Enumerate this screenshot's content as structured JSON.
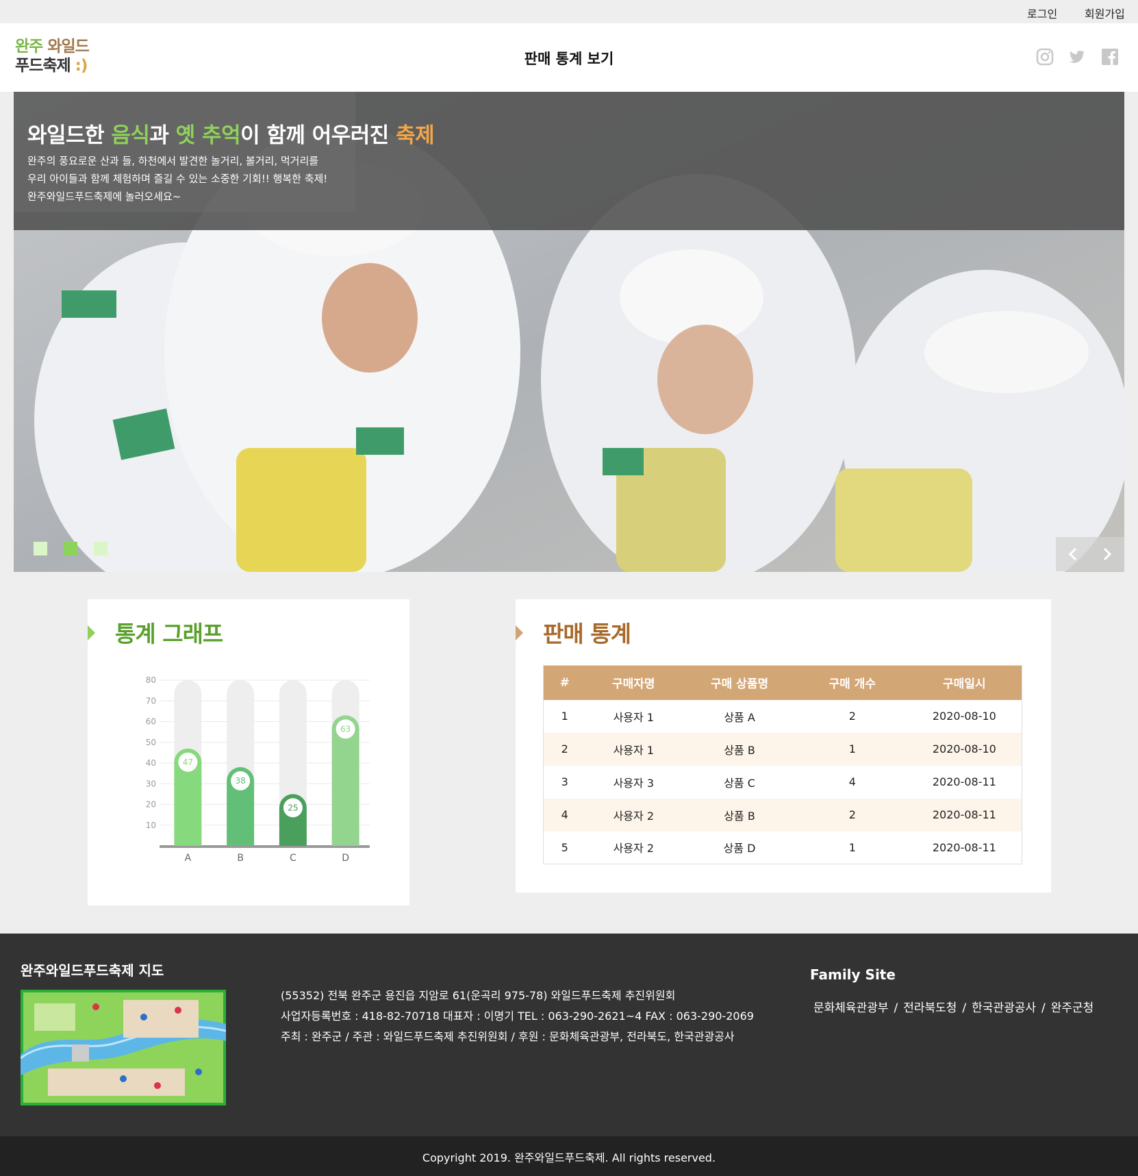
{
  "topbar": {
    "login": "로그인",
    "signup": "회원가입"
  },
  "header": {
    "logo_line1_a": "완주",
    "logo_line1_b": " 와일드",
    "logo_line2": "푸드축제",
    "logo_smile": ":)",
    "page_title": "판매 통계 보기",
    "social": [
      "instagram-icon",
      "twitter-icon",
      "facebook-icon"
    ]
  },
  "hero": {
    "headline": {
      "p1": "와일드한 ",
      "p2": "음식",
      "p3": "과 ",
      "p4": "옛 추억",
      "p5": "이 함께 어우러진 ",
      "p6": "축제"
    },
    "desc_lines": [
      "완주의 풍요로운 산과 들, 하천에서 발견한 놀거리, 볼거리, 먹거리를",
      "우리 아이들과 함께 체험하며 즐길 수 있는 소중한 기회!! 행복한 축제!",
      "완주와일드푸드축제에 놀러오세요~"
    ],
    "slide_count": 3,
    "active_slide": 1
  },
  "graph": {
    "title": "통계 그래프",
    "chart_data": {
      "type": "bar",
      "categories": [
        "A",
        "B",
        "C",
        "D"
      ],
      "values": [
        47,
        38,
        25,
        63
      ],
      "ylim": [
        0,
        80
      ],
      "yticks": [
        10,
        20,
        30,
        40,
        50,
        60,
        70,
        80
      ],
      "grid": true,
      "bar_colors": [
        "#86d97c",
        "#62bf77",
        "#4a9f5c",
        "#93d48f"
      ],
      "track_color": "#eeeeee"
    }
  },
  "stats": {
    "title": "판매 통계",
    "columns": [
      "#",
      "구매자명",
      "구매 상품명",
      "구매 개수",
      "구매일시"
    ],
    "rows": [
      [
        "1",
        "사용자 1",
        "상품 A",
        "2",
        "2020-08-10"
      ],
      [
        "2",
        "사용자 1",
        "상품 B",
        "1",
        "2020-08-10"
      ],
      [
        "3",
        "사용자 3",
        "상품 C",
        "4",
        "2020-08-11"
      ],
      [
        "4",
        "사용자 2",
        "상품 B",
        "2",
        "2020-08-11"
      ],
      [
        "5",
        "사용자 2",
        "상품 D",
        "1",
        "2020-08-11"
      ]
    ]
  },
  "footer": {
    "map_title": "완주와일드푸드축제 지도",
    "addr_lines": [
      "(55352) 전북 완주군 용진읍 지암로 61(운곡리 975-78) 와일드푸드축제 추진위원회",
      "사업자등록번호 : 418-82-70718 대표자 : 이명기 TEL : 063-290-2621~4 FAX : 063-290-2069",
      "주최 : 완주군 / 주관 : 와일드푸드축제 추진위원회 / 후원 : 문화체육관광부, 전라북도, 한국관광공사"
    ],
    "family_title": "Family Site",
    "family_links": [
      "문화체육관광부",
      "전라북도청",
      "한국관광공사",
      "완주군청"
    ],
    "family_sep": "/",
    "copyright": "Copyright 2019. 완주와일드푸드축제. All rights reserved."
  }
}
